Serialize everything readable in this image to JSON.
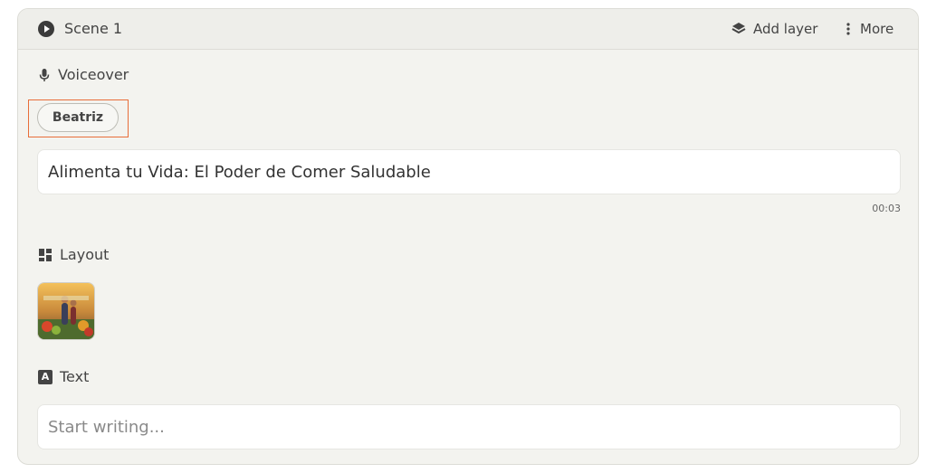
{
  "header": {
    "scene_title": "Scene 1",
    "add_layer_label": "Add layer",
    "more_label": "More"
  },
  "voiceover": {
    "label": "Voiceover",
    "voice_name": "Beatriz",
    "script_text": "Alimenta tu Vida: El Poder de Comer Saludable",
    "duration": "00:03"
  },
  "layout": {
    "label": "Layout"
  },
  "text_section": {
    "label": "Text",
    "badge": "A",
    "placeholder": "Start writing..."
  },
  "colors": {
    "highlight": "#e86e3a",
    "card_bg": "#f3f3ef"
  }
}
